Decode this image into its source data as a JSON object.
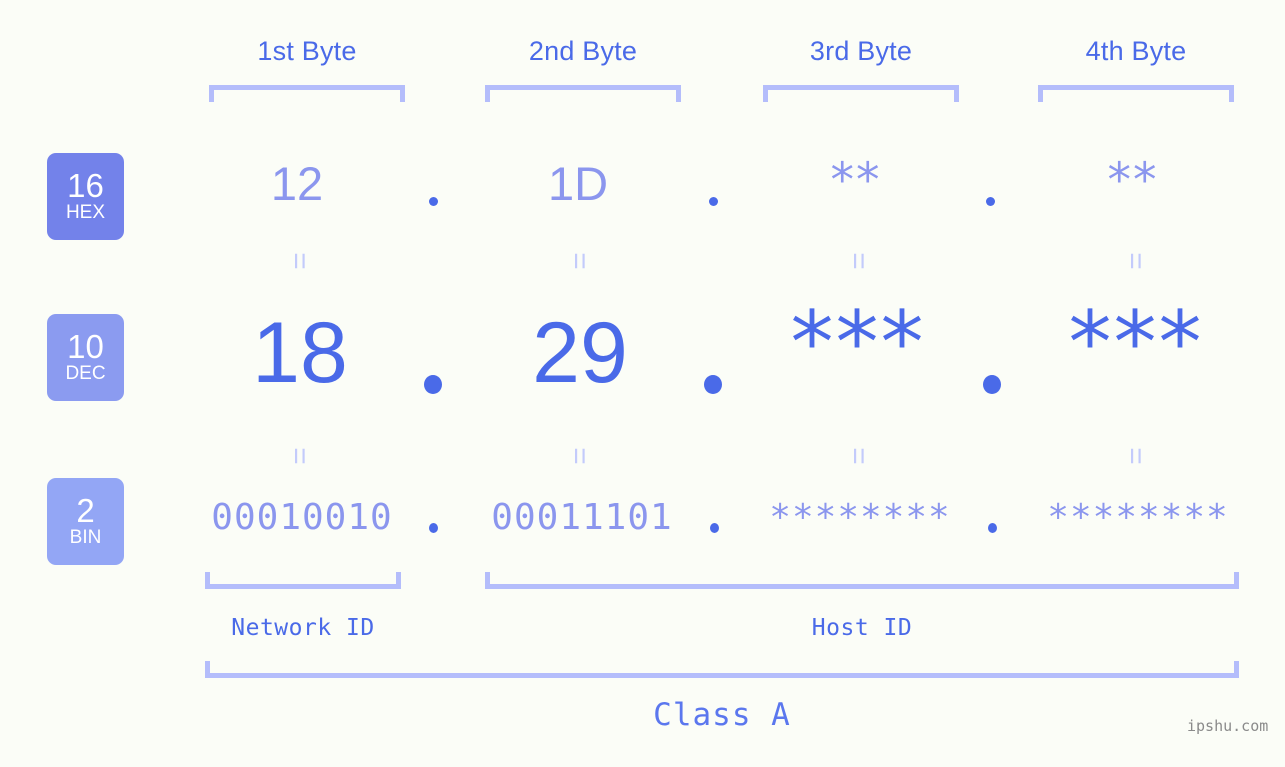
{
  "page": {
    "background_color": "#fbfdf7",
    "accent_dark": "#4a6ae8",
    "accent_light": "#8b96ee",
    "accent_pale": "#b4bdfb"
  },
  "byte_headers": [
    {
      "label": "1st Byte"
    },
    {
      "label": "2nd Byte"
    },
    {
      "label": "3rd Byte"
    },
    {
      "label": "4th Byte"
    }
  ],
  "bases": [
    {
      "number": "16",
      "name": "HEX",
      "color": "#7382ea"
    },
    {
      "number": "10",
      "name": "DEC",
      "color": "#8b9bf0"
    },
    {
      "number": "2",
      "name": "BIN",
      "color": "#93a6f5"
    }
  ],
  "rows": {
    "hex": {
      "values": [
        "12",
        "1D",
        "**",
        "**"
      ]
    },
    "dec": {
      "values": [
        "18",
        "29",
        "***",
        "***"
      ]
    },
    "bin": {
      "values": [
        "00010010",
        "00011101",
        "********",
        "********"
      ]
    }
  },
  "separators": {
    "dot": ".",
    "equals": "="
  },
  "segments": [
    {
      "label": "Network ID"
    },
    {
      "label": "Host ID"
    }
  ],
  "class": {
    "label": "Class A"
  },
  "watermark": {
    "text": "ipshu.com"
  }
}
